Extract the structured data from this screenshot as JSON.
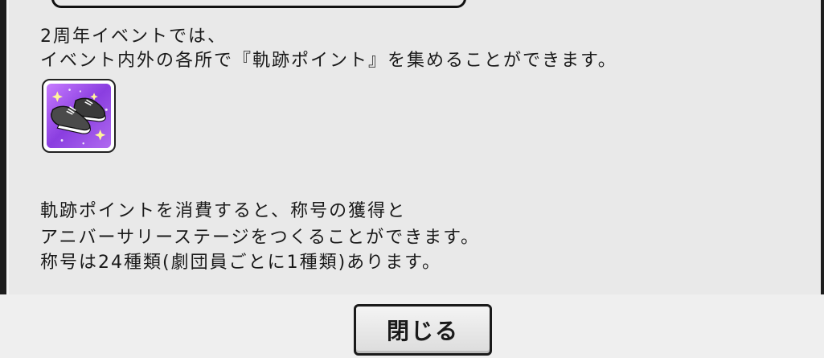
{
  "dialog": {
    "lines_top": [
      "2周年イベントでは、",
      "イベント内外の各所で『軌跡ポイント』を集めることができます。"
    ],
    "item_icon": "sneakers-icon",
    "lines_bottom": [
      "軌跡ポイントを消費すると、称号の獲得と",
      "アニバーサリーステージをつくることができます。",
      "称号は24種類(劇団員ごとに1種類)あります。"
    ]
  },
  "footer": {
    "close_label": "閉じる"
  },
  "colors": {
    "background": "#e9e9e9",
    "frame": "#1d1d1d",
    "text": "#1a1a1a",
    "icon_background": "#9b4fe0"
  }
}
